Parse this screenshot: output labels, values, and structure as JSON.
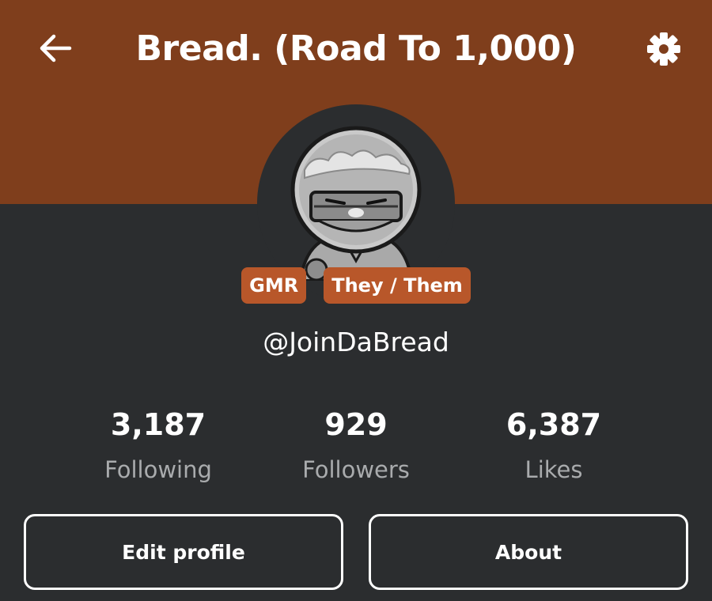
{
  "header": {
    "title": "Bread. (Road To 1,000)",
    "back_icon": "arrow-left-icon",
    "settings_icon": "gear-icon",
    "banner_color": "#7f3e1c"
  },
  "profile": {
    "badges": [
      "GMR",
      "They / Them"
    ],
    "handle": "@JoinDaBread",
    "badge_color": "#b8572a"
  },
  "stats": {
    "following": {
      "value": "3,187",
      "label": "Following"
    },
    "followers": {
      "value": "929",
      "label": "Followers"
    },
    "likes": {
      "value": "6,387",
      "label": "Likes"
    }
  },
  "actions": {
    "edit_profile": "Edit profile",
    "about": "About"
  }
}
